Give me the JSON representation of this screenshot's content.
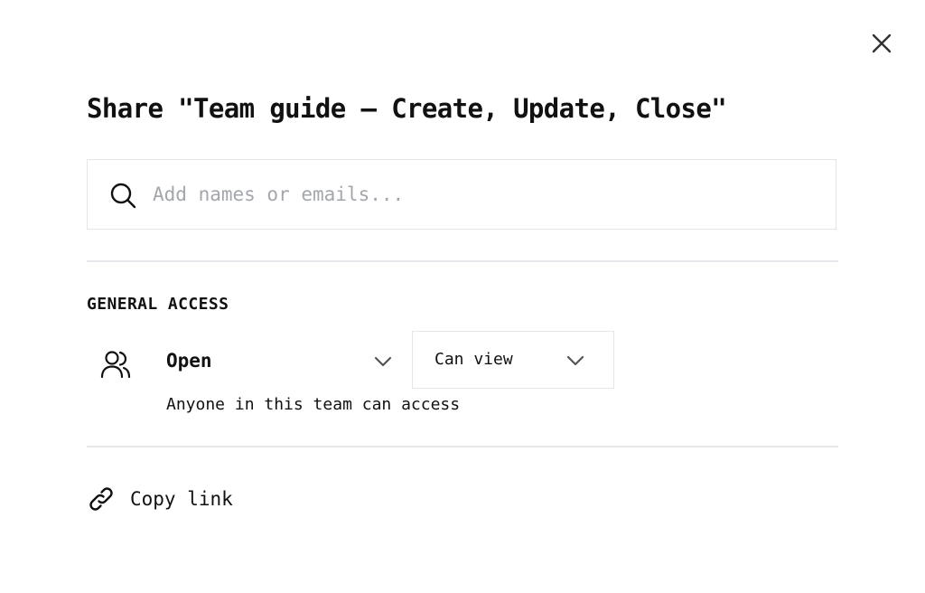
{
  "dialog": {
    "title": "Share \"Team guide — Create, Update, Close\"",
    "close_icon": "close-icon"
  },
  "search": {
    "placeholder": "Add names or emails...",
    "value": "",
    "icon": "search-icon"
  },
  "general_access": {
    "section_label": "GENERAL ACCESS",
    "icon": "users-icon",
    "access_value": "Open",
    "permission_value": "Can view",
    "description": "Anyone in this team can access"
  },
  "copy_link": {
    "label": "Copy link",
    "icon": "link-icon"
  },
  "colors": {
    "text": "#111111",
    "placeholder": "#a3a7ad",
    "border": "#e3e6ea",
    "divider": "#e5e7eb",
    "background": "#ffffff"
  }
}
